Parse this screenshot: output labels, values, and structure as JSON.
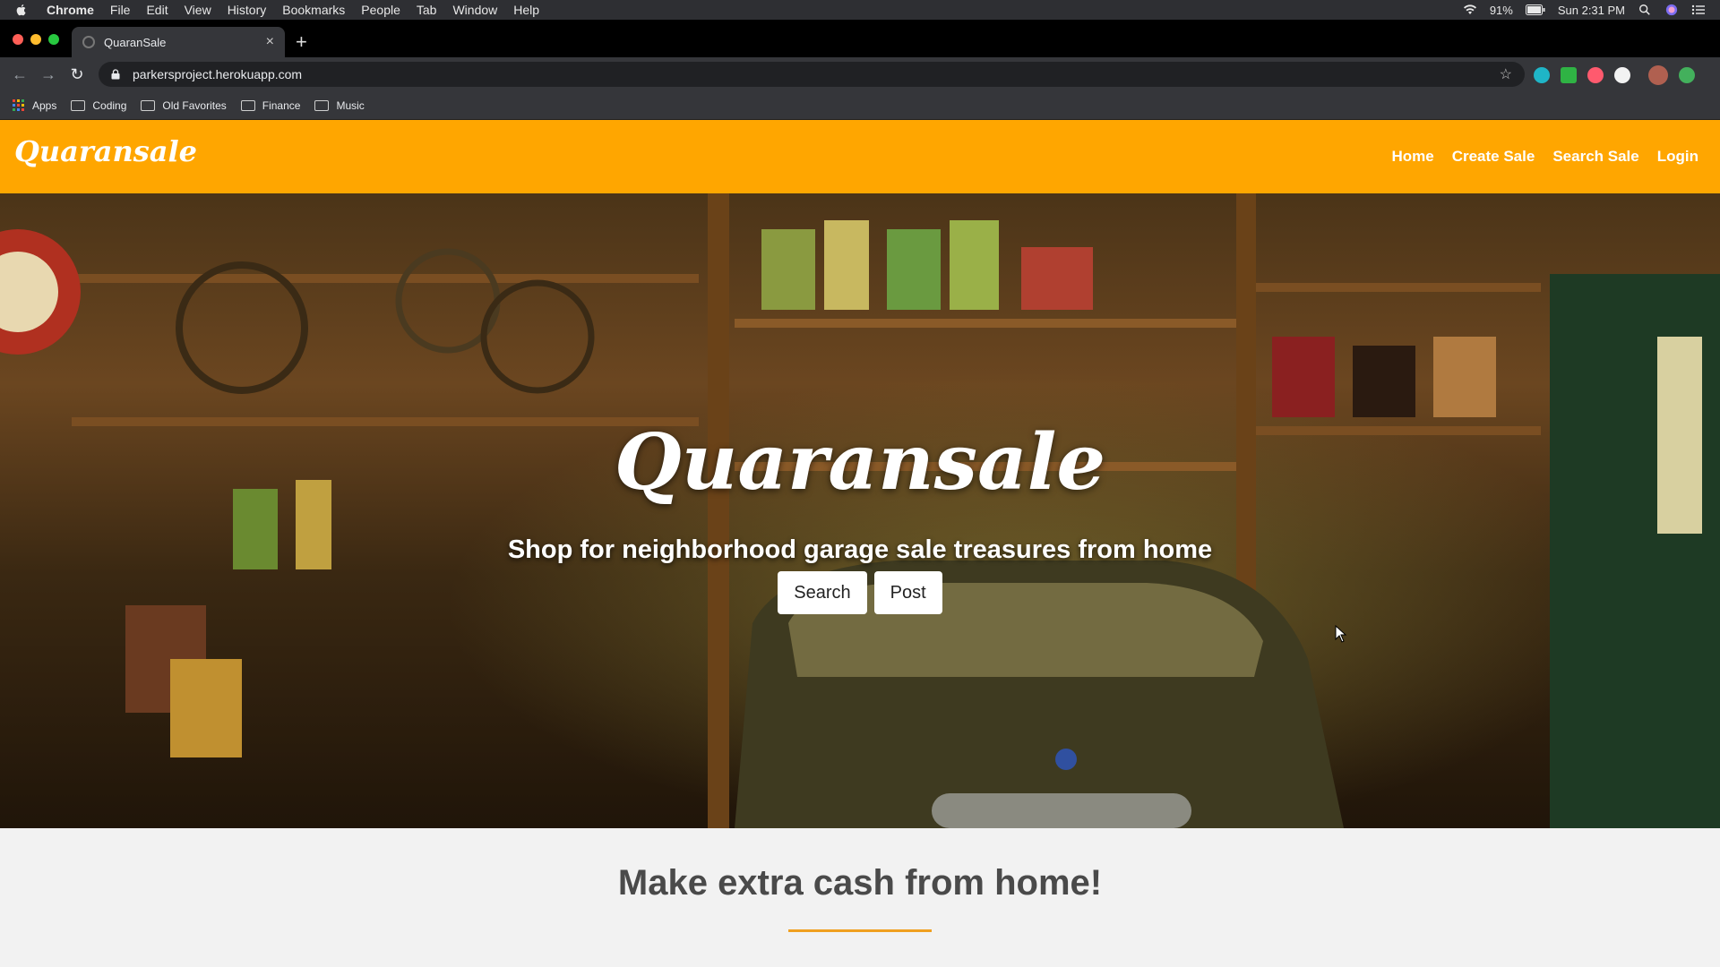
{
  "menubar": {
    "app_name": "Chrome",
    "items": [
      "File",
      "Edit",
      "View",
      "History",
      "Bookmarks",
      "People",
      "Tab",
      "Window",
      "Help"
    ],
    "battery": "91%",
    "clock": "Sun 2:31 PM"
  },
  "browser": {
    "tab_title": "QuaranSale",
    "url": "parkersproject.herokuapp.com",
    "bookmarks": [
      "Apps",
      "Coding",
      "Old Favorites",
      "Finance",
      "Music"
    ]
  },
  "site": {
    "brand": "Quaransale",
    "nav": [
      "Home",
      "Create Sale",
      "Search Sale",
      "Login"
    ],
    "accent_color": "#ffa600"
  },
  "hero": {
    "title": "Quaransale",
    "subtitle": "Shop for neighborhood garage sale treasures from home",
    "buttons": [
      "Search",
      "Post"
    ]
  },
  "section": {
    "heading": "Make extra cash from home!"
  }
}
